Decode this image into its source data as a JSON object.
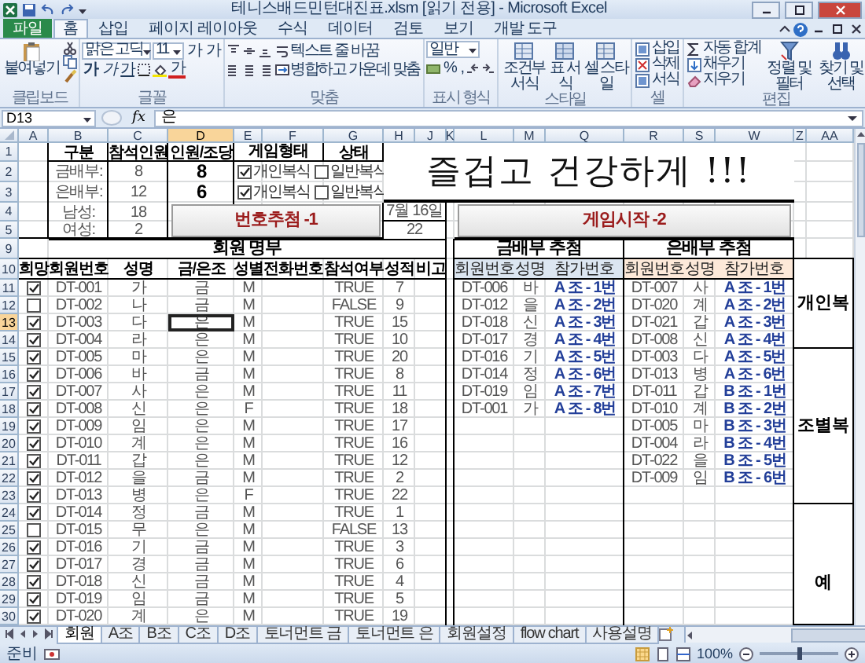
{
  "window": {
    "title": "테니스배드민턴대진표.xlsm [읽기 전용] - Microsoft Excel"
  },
  "ribbon_tabs": [
    {
      "label": "파일",
      "kind": "file",
      "selected": false
    },
    {
      "label": "홈",
      "kind": "tab",
      "selected": true
    },
    {
      "label": "삽입",
      "kind": "tab",
      "selected": false
    },
    {
      "label": "페이지 레이아웃",
      "kind": "tab",
      "selected": false
    },
    {
      "label": "수식",
      "kind": "tab",
      "selected": false
    },
    {
      "label": "데이터",
      "kind": "tab",
      "selected": false
    },
    {
      "label": "검토",
      "kind": "tab",
      "selected": false
    },
    {
      "label": "보기",
      "kind": "tab",
      "selected": false
    },
    {
      "label": "개발 도구",
      "kind": "tab",
      "selected": false
    }
  ],
  "ribbon": {
    "clipboard": {
      "paste": "붙여넣기",
      "label": "클립보드"
    },
    "font": {
      "name": "맑은 고딕",
      "size": "11",
      "grow": "가",
      "shrink": "가",
      "bold": "가",
      "italic": "가",
      "underline": "가",
      "font_color": "가",
      "label": "글꼴"
    },
    "alignment": {
      "wrap": "텍스트 줄 바꿈",
      "merge": "병합하고 가운데 맞춤",
      "label": "맞춤"
    },
    "number": {
      "format": "일반",
      "percent": "%",
      "comma": ",",
      "label": "표시 형식"
    },
    "styles": {
      "buttons": [
        "조건부 서식",
        "표 서식",
        "셀 스타일"
      ],
      "label": "스타일"
    },
    "cells": {
      "buttons": [
        "삽입",
        "삭제",
        "서식"
      ],
      "label": "셀"
    },
    "editing": {
      "autosum": "자동 합계",
      "fill": "채우기",
      "clear": "지우기",
      "buttons": [
        "정렬 및 필터",
        "찾기 및 선택"
      ],
      "label": "편집"
    }
  },
  "formula_bar": {
    "name_box": "D13",
    "function_label": "fx",
    "formula": "은"
  },
  "sheet": {
    "columns": [
      {
        "label": "A",
        "selected": false
      },
      {
        "label": "B",
        "selected": false
      },
      {
        "label": "C",
        "selected": false
      },
      {
        "label": "D",
        "selected": true
      },
      {
        "label": "E",
        "selected": false
      },
      {
        "label": "F",
        "selected": false
      },
      {
        "label": "G",
        "selected": false
      },
      {
        "label": "H",
        "selected": false
      },
      {
        "label": "J",
        "selected": false
      },
      {
        "label": "K",
        "selected": false
      },
      {
        "label": "L",
        "selected": false
      },
      {
        "label": "M",
        "selected": false
      },
      {
        "label": "Q",
        "selected": false
      },
      {
        "label": "R",
        "selected": false
      },
      {
        "label": "S",
        "selected": false
      },
      {
        "label": "W",
        "selected": false
      },
      {
        "label": "Z",
        "selected": false
      },
      {
        "label": "AA",
        "selected": false
      }
    ],
    "rows": [
      {
        "label": "1",
        "selected": false
      },
      {
        "label": "2",
        "selected": false
      },
      {
        "label": "3",
        "selected": false
      },
      {
        "label": "4",
        "selected": false
      },
      {
        "label": "5",
        "selected": false
      },
      {
        "label": "9",
        "selected": false
      },
      {
        "label": "10",
        "selected": false
      },
      {
        "label": "11",
        "selected": false
      },
      {
        "label": "12",
        "selected": false
      },
      {
        "label": "13",
        "selected": true
      },
      {
        "label": "14",
        "selected": false
      },
      {
        "label": "15",
        "selected": false
      },
      {
        "label": "16",
        "selected": false
      },
      {
        "label": "17",
        "selected": false
      },
      {
        "label": "18",
        "selected": false
      },
      {
        "label": "19",
        "selected": false
      },
      {
        "label": "20",
        "selected": false
      },
      {
        "label": "21",
        "selected": false
      },
      {
        "label": "22",
        "selected": false
      },
      {
        "label": "23",
        "selected": false
      },
      {
        "label": "24",
        "selected": false
      },
      {
        "label": "25",
        "selected": false
      },
      {
        "label": "26",
        "selected": false
      },
      {
        "label": "27",
        "selected": false
      },
      {
        "label": "28",
        "selected": false
      },
      {
        "label": "29",
        "selected": false
      },
      {
        "label": "30",
        "selected": false
      }
    ]
  },
  "summary": {
    "headers": [
      "구분",
      "참석인원",
      "인원/조당",
      "게임형태",
      "상태"
    ],
    "groups": [
      {
        "label": "금배부:",
        "attendance": "8",
        "per_team": "8",
        "game_types": [
          {
            "label": "개인복식",
            "checked": true
          },
          {
            "label": "일반복식",
            "checked": false
          }
        ]
      },
      {
        "label": "은배부:",
        "attendance": "12",
        "per_team": "6",
        "game_types": [
          {
            "label": "개인복식",
            "checked": true
          },
          {
            "label": "일반복식",
            "checked": false
          }
        ]
      }
    ],
    "genders": [
      {
        "label": "남성:",
        "count": "18"
      },
      {
        "label": "여성:",
        "count": "2"
      }
    ]
  },
  "banner": "즐겁고 건강하게 !!!",
  "draw_button": "번호추첨 -1",
  "date": "7월 16일",
  "total": "22",
  "start_button": "게임시작 -2",
  "roster": {
    "title": "회원 명부",
    "columns": [
      "희망",
      "회원번호",
      "성명",
      "금/은조",
      "성별",
      "전화번호",
      "참석여부",
      "성적",
      "비고"
    ],
    "rows": [
      {
        "hope": true,
        "id": "DT-001",
        "name": "가",
        "group": "금",
        "gender": "M",
        "attend": "TRUE",
        "score": "7",
        "active": false
      },
      {
        "hope": false,
        "id": "DT-002",
        "name": "나",
        "group": "금",
        "gender": "M",
        "attend": "FALSE",
        "score": "9",
        "active": false
      },
      {
        "hope": true,
        "id": "DT-003",
        "name": "다",
        "group": "은",
        "gender": "M",
        "attend": "TRUE",
        "score": "15",
        "active": true
      },
      {
        "hope": true,
        "id": "DT-004",
        "name": "라",
        "group": "은",
        "gender": "M",
        "attend": "TRUE",
        "score": "10",
        "active": false
      },
      {
        "hope": true,
        "id": "DT-005",
        "name": "마",
        "group": "은",
        "gender": "M",
        "attend": "TRUE",
        "score": "20",
        "active": false
      },
      {
        "hope": true,
        "id": "DT-006",
        "name": "바",
        "group": "금",
        "gender": "M",
        "attend": "TRUE",
        "score": "8",
        "active": false
      },
      {
        "hope": true,
        "id": "DT-007",
        "name": "사",
        "group": "은",
        "gender": "M",
        "attend": "TRUE",
        "score": "11",
        "active": false
      },
      {
        "hope": true,
        "id": "DT-008",
        "name": "신",
        "group": "은",
        "gender": "F",
        "attend": "TRUE",
        "score": "18",
        "active": false
      },
      {
        "hope": true,
        "id": "DT-009",
        "name": "임",
        "group": "은",
        "gender": "M",
        "attend": "TRUE",
        "score": "17",
        "active": false
      },
      {
        "hope": true,
        "id": "DT-010",
        "name": "계",
        "group": "은",
        "gender": "M",
        "attend": "TRUE",
        "score": "16",
        "active": false
      },
      {
        "hope": true,
        "id": "DT-011",
        "name": "갑",
        "group": "은",
        "gender": "M",
        "attend": "TRUE",
        "score": "12",
        "active": false
      },
      {
        "hope": true,
        "id": "DT-012",
        "name": "을",
        "group": "금",
        "gender": "M",
        "attend": "TRUE",
        "score": "2",
        "active": false
      },
      {
        "hope": true,
        "id": "DT-013",
        "name": "병",
        "group": "은",
        "gender": "F",
        "attend": "TRUE",
        "score": "22",
        "active": false
      },
      {
        "hope": true,
        "id": "DT-014",
        "name": "정",
        "group": "금",
        "gender": "M",
        "attend": "TRUE",
        "score": "1",
        "active": false
      },
      {
        "hope": false,
        "id": "DT-015",
        "name": "무",
        "group": "은",
        "gender": "M",
        "attend": "FALSE",
        "score": "13",
        "active": false
      },
      {
        "hope": true,
        "id": "DT-016",
        "name": "기",
        "group": "금",
        "gender": "M",
        "attend": "TRUE",
        "score": "3",
        "active": false
      },
      {
        "hope": true,
        "id": "DT-017",
        "name": "경",
        "group": "금",
        "gender": "M",
        "attend": "TRUE",
        "score": "6",
        "active": false
      },
      {
        "hope": true,
        "id": "DT-018",
        "name": "신",
        "group": "금",
        "gender": "M",
        "attend": "TRUE",
        "score": "4",
        "active": false
      },
      {
        "hope": true,
        "id": "DT-019",
        "name": "임",
        "group": "금",
        "gender": "M",
        "attend": "TRUE",
        "score": "5",
        "active": false
      },
      {
        "hope": true,
        "id": "DT-020",
        "name": "계",
        "group": "은",
        "gender": "M",
        "attend": "TRUE",
        "score": "19",
        "active": false
      }
    ]
  },
  "gold_draw": {
    "title": "금배부 추첨",
    "columns": [
      "회원번호",
      "성명",
      "참가번호"
    ],
    "rows": [
      {
        "id": "DT-006",
        "name": "바",
        "entry": "A 조 - 1번"
      },
      {
        "id": "DT-012",
        "name": "을",
        "entry": "A 조 - 2번"
      },
      {
        "id": "DT-018",
        "name": "신",
        "entry": "A 조 - 3번"
      },
      {
        "id": "DT-017",
        "name": "경",
        "entry": "A 조 - 4번"
      },
      {
        "id": "DT-016",
        "name": "기",
        "entry": "A 조 - 5번"
      },
      {
        "id": "DT-014",
        "name": "정",
        "entry": "A 조 - 6번"
      },
      {
        "id": "DT-019",
        "name": "임",
        "entry": "A 조 - 7번"
      },
      {
        "id": "DT-001",
        "name": "가",
        "entry": "A 조 - 8번"
      }
    ]
  },
  "silver_draw": {
    "title": "은배부 추첨",
    "columns": [
      "회원번호",
      "성명",
      "참가번호"
    ],
    "rows": [
      {
        "id": "DT-007",
        "name": "사",
        "entry": "A 조 - 1번"
      },
      {
        "id": "DT-020",
        "name": "계",
        "entry": "A 조 - 2번"
      },
      {
        "id": "DT-021",
        "name": "갑",
        "entry": "A 조 - 3번"
      },
      {
        "id": "DT-008",
        "name": "신",
        "entry": "A 조 - 4번"
      },
      {
        "id": "DT-003",
        "name": "다",
        "entry": "A 조 - 5번"
      },
      {
        "id": "DT-013",
        "name": "병",
        "entry": "A 조 - 6번"
      },
      {
        "id": "DT-011",
        "name": "갑",
        "entry": "B 조 - 1번"
      },
      {
        "id": "DT-010",
        "name": "계",
        "entry": "B 조 - 2번"
      },
      {
        "id": "DT-005",
        "name": "마",
        "entry": "B 조 - 3번"
      },
      {
        "id": "DT-004",
        "name": "라",
        "entry": "B 조 - 4번"
      },
      {
        "id": "DT-022",
        "name": "을",
        "entry": "B 조 - 5번"
      },
      {
        "id": "DT-009",
        "name": "임",
        "entry": "B 조 - 6번"
      }
    ]
  },
  "side_labels": [
    "개인복",
    "조별복",
    "예"
  ],
  "sheet_tabs": [
    {
      "label": "회원",
      "selected": true
    },
    {
      "label": "A조",
      "selected": false
    },
    {
      "label": "B조",
      "selected": false
    },
    {
      "label": "C조",
      "selected": false
    },
    {
      "label": "D조",
      "selected": false
    },
    {
      "label": "토너먼트 금",
      "selected": false
    },
    {
      "label": "토너먼트 은",
      "selected": false
    },
    {
      "label": "회원설정",
      "selected": false
    },
    {
      "label": "flow chart",
      "selected": false
    },
    {
      "label": "사용설명",
      "selected": false
    }
  ],
  "status_bar": {
    "status": "준비",
    "zoom": "100%",
    "zoom_slider": {
      "level": 0.5
    }
  }
}
